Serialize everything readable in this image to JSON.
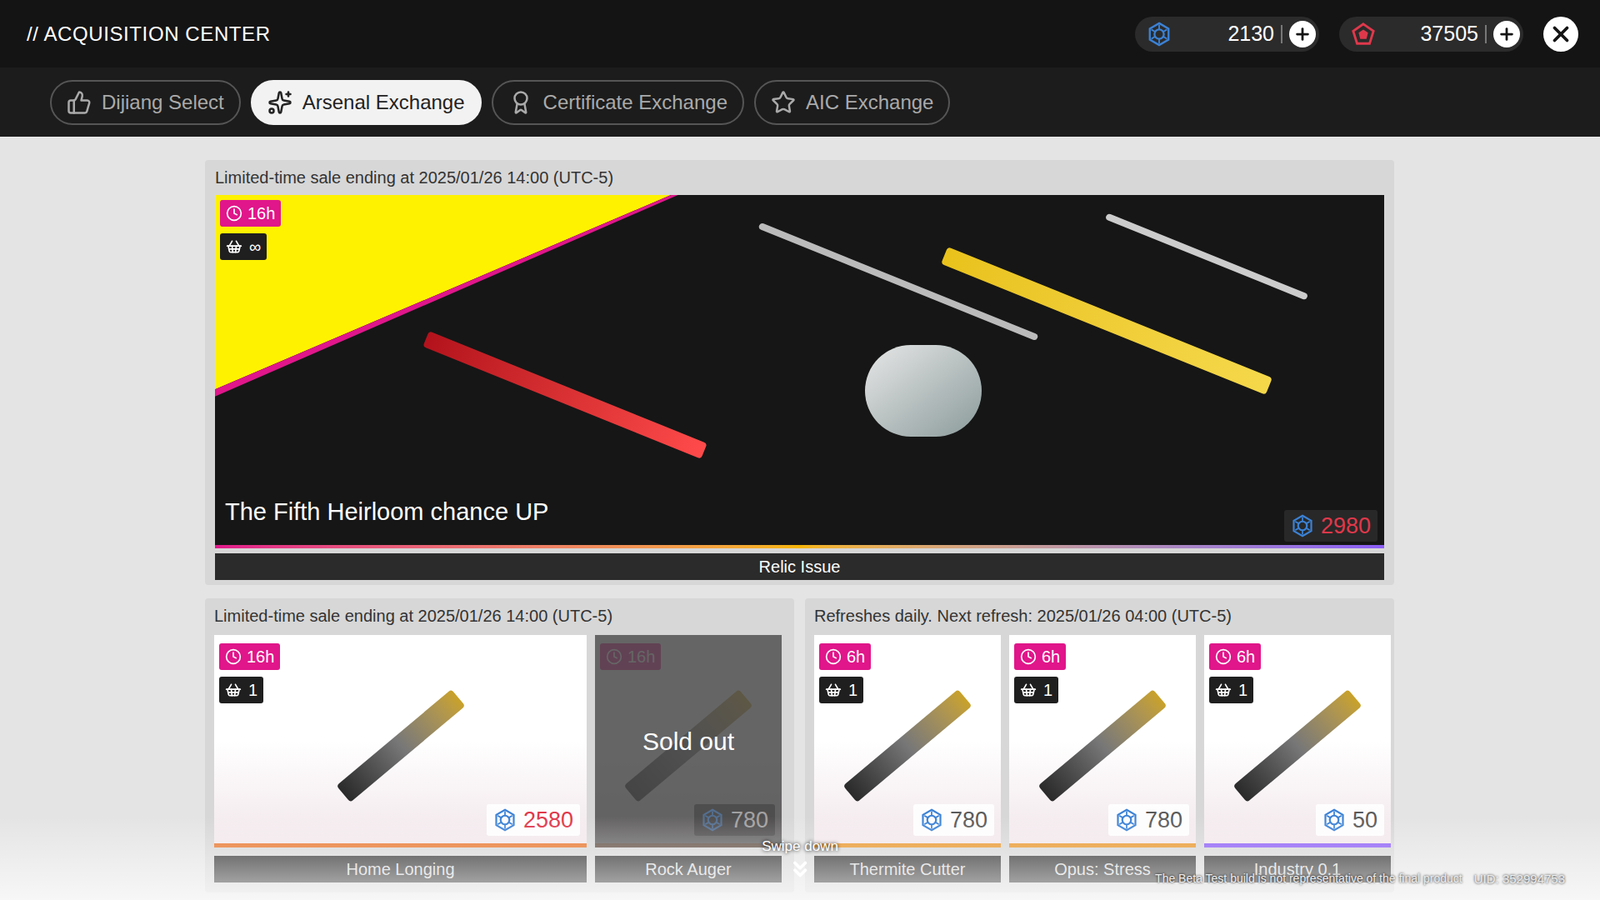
{
  "header": {
    "title": "// ACQUISITION CENTER",
    "currencies": [
      {
        "kind": "arsenal",
        "amount": "2130"
      },
      {
        "kind": "origeometry",
        "amount": "37505"
      }
    ]
  },
  "tabs": [
    {
      "label": "Dijiang Select",
      "selected": false,
      "kind": "select"
    },
    {
      "label": "Arsenal Exchange",
      "selected": true,
      "kind": "arsenal"
    },
    {
      "label": "Certificate Exchange",
      "selected": false,
      "kind": "certificate"
    },
    {
      "label": "AIC Exchange",
      "selected": false,
      "kind": "aic"
    }
  ],
  "featured": {
    "header": "Limited-time sale ending at 2025/01/26 14:00 (UTC-5)",
    "timer": "16h",
    "stock": "∞",
    "title": "The Fifth Heirloom chance UP",
    "price": "2980",
    "price_emphasis": true,
    "name": "Relic Issue"
  },
  "sold_out_label": "Sold out",
  "sections": [
    {
      "header": "Limited-time sale ending at 2025/01/26 14:00 (UTC-5)",
      "items": [
        {
          "name": "Home Longing",
          "kind": "wide",
          "timer": "16h",
          "stock": "1",
          "price": "2580",
          "price_emphasis": true,
          "sold_out": false,
          "color": "#e8742a"
        },
        {
          "name": "Rock Auger",
          "kind": "standard",
          "timer": "16h",
          "price": "780",
          "price_emphasis": false,
          "sold_out": true,
          "color": "#e8742a"
        }
      ]
    },
    {
      "header": "Refreshes daily. Next refresh: 2025/01/26 04:00 (UTC-5)",
      "items": [
        {
          "name": "Thermite Cutter",
          "kind": "standard",
          "timer": "6h",
          "stock": "1",
          "price": "780",
          "price_emphasis": false,
          "sold_out": false,
          "color": "#e8962a"
        },
        {
          "name": "Opus: Stress",
          "kind": "standard",
          "timer": "6h",
          "stock": "1",
          "price": "780",
          "price_emphasis": false,
          "sold_out": false,
          "color": "#e8962a"
        },
        {
          "name": "Industry 0.1",
          "kind": "standard",
          "timer": "6h",
          "stock": "1",
          "price": "50",
          "price_emphasis": false,
          "sold_out": false,
          "color": "#8b5cf6"
        }
      ]
    }
  ],
  "footer": {
    "hint": "Swipe down",
    "notice": "The Beta Test build is not representative of the final product",
    "uid": "UID: 352994753"
  }
}
